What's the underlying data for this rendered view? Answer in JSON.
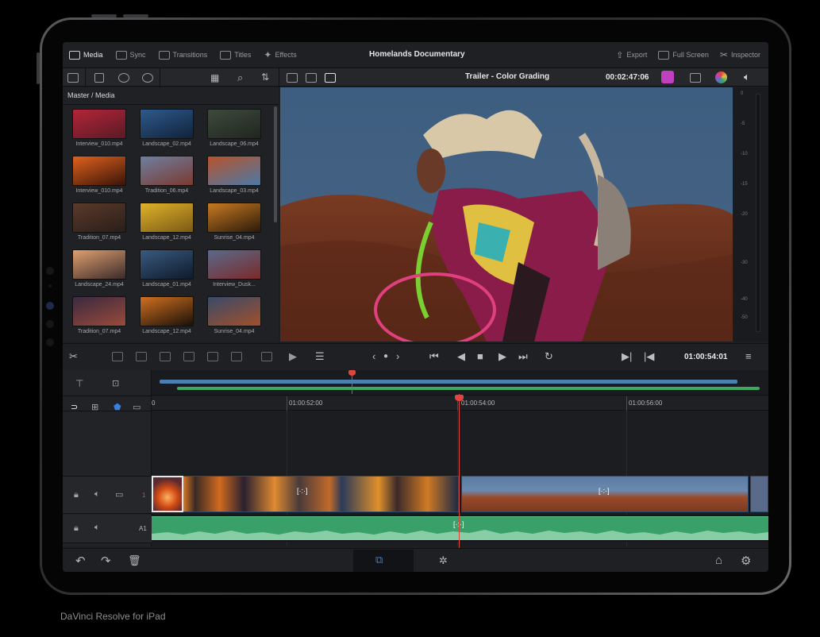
{
  "top_bar": {
    "tabs": [
      {
        "label": "Media",
        "icon": "media-icon",
        "active": true
      },
      {
        "label": "Sync",
        "icon": "sync-icon"
      },
      {
        "label": "Transitions",
        "icon": "transitions-icon"
      },
      {
        "label": "Titles",
        "icon": "titles-icon"
      },
      {
        "label": "Effects",
        "icon": "effects-icon"
      }
    ],
    "project_title": "Homelands Documentary",
    "right_actions": [
      {
        "label": "Export",
        "icon": "export-icon"
      },
      {
        "label": "Full Screen",
        "icon": "fullscreen-icon"
      },
      {
        "label": "Inspector",
        "icon": "inspector-icon"
      }
    ]
  },
  "viewer_bar": {
    "clip_title": "Trailer - Color Grading",
    "timecode": "00:02:47:06"
  },
  "media_pool": {
    "path": "Master / Media",
    "clips": [
      {
        "name": "Interview_010.mp4",
        "color": "#b3253a",
        "color2": "#5a1a24"
      },
      {
        "name": "Landscape_02.mp4",
        "color": "#2e5a8c",
        "color2": "#11223a"
      },
      {
        "name": "Landscape_06.mp4",
        "color": "#3e4a3c",
        "color2": "#20261f"
      },
      {
        "name": "Interview_010.mp4",
        "color": "#e0621e",
        "color2": "#3a1408"
      },
      {
        "name": "Tradition_06.mp4",
        "color": "#6e7fa0",
        "color2": "#7a3a30"
      },
      {
        "name": "Landscape_03.mp4",
        "color": "#b8522a",
        "color2": "#4a7aa8"
      },
      {
        "name": "Tradition_07.mp4",
        "color": "#5a3a2c",
        "color2": "#2a1e18"
      },
      {
        "name": "Landscape_12.mp4",
        "color": "#e0b22a",
        "color2": "#7a5a14"
      },
      {
        "name": "Sunrise_04.mp4",
        "color": "#c87a22",
        "color2": "#2a1a0a"
      },
      {
        "name": "Landscape_24.mp4",
        "color": "#e0a070",
        "color2": "#3a2a2a"
      },
      {
        "name": "Landscape_01.mp4",
        "color": "#3a5a80",
        "color2": "#0e1a2a"
      },
      {
        "name": "Interview_Dusk...",
        "color": "#5a6a8a",
        "color2": "#7a2a2a"
      },
      {
        "name": "Tradition_07.mp4",
        "color": "#3a2a40",
        "color2": "#9a4a3a"
      },
      {
        "name": "Landscape_12.mp4",
        "color": "#d07020",
        "color2": "#1a1008"
      },
      {
        "name": "Sunrise_04.mp4",
        "color": "#3a4a6a",
        "color2": "#a0502a"
      }
    ]
  },
  "audio_meter": {
    "ticks": [
      "0",
      "-5",
      "-10",
      "-15",
      "-20",
      "-30",
      "-40",
      "-50"
    ]
  },
  "transport": {
    "timecode": "01:00:54:01"
  },
  "timeline": {
    "ruler_labels": [
      "0",
      "01:00:52:00",
      "01:00:54:00",
      "01:00:56:00"
    ],
    "tracks": [
      {
        "label": "1",
        "color": "#e0453e"
      },
      {
        "label": "A1",
        "color": "#b5b5b5"
      }
    ],
    "clip_colors": {
      "video_clip_a": "#1e3a5a",
      "video_clip_b": "#2a4a6a",
      "audio_clip": "#3aa06a"
    }
  },
  "colors": {
    "accent_red": "#e0453e",
    "minimap_blue": "#4a7fb0",
    "minimap_green": "#3fa865",
    "background": "#1d1e22"
  },
  "caption": "DaVinci Resolve for iPad"
}
